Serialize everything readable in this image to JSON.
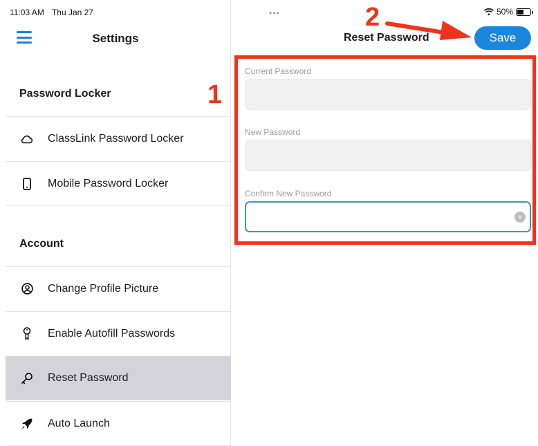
{
  "status_bar": {
    "time": "11:03 AM",
    "date": "Thu Jan 27",
    "dots": "•••",
    "battery": "50%",
    "battery_level": 0.5
  },
  "sidebar": {
    "title": "Settings",
    "sections": [
      {
        "heading": "Password Locker",
        "items": [
          {
            "label": "ClassLink Password Locker",
            "icon": "cloud-icon"
          },
          {
            "label": "Mobile Password Locker",
            "icon": "phone-icon"
          }
        ]
      },
      {
        "heading": "Account",
        "items": [
          {
            "label": "Change Profile Picture",
            "icon": "user-circle-icon"
          },
          {
            "label": "Enable Autofill Passwords",
            "icon": "keyhole-icon"
          },
          {
            "label": "Reset Password",
            "icon": "key-icon",
            "selected": true
          },
          {
            "label": "Auto Launch",
            "icon": "rocket-icon"
          }
        ]
      }
    ]
  },
  "main": {
    "title": "Reset Password",
    "save_label": "Save",
    "fields": [
      {
        "label": "Current Password",
        "value": ""
      },
      {
        "label": "New Password",
        "value": ""
      },
      {
        "label": "Confirm New Password",
        "value": ""
      }
    ]
  },
  "annotations": {
    "step1": "1",
    "step2": "2"
  },
  "colors": {
    "accent": "#1a87dc",
    "annotation": "#f0331c",
    "selected_row": "#d4d3d9"
  }
}
